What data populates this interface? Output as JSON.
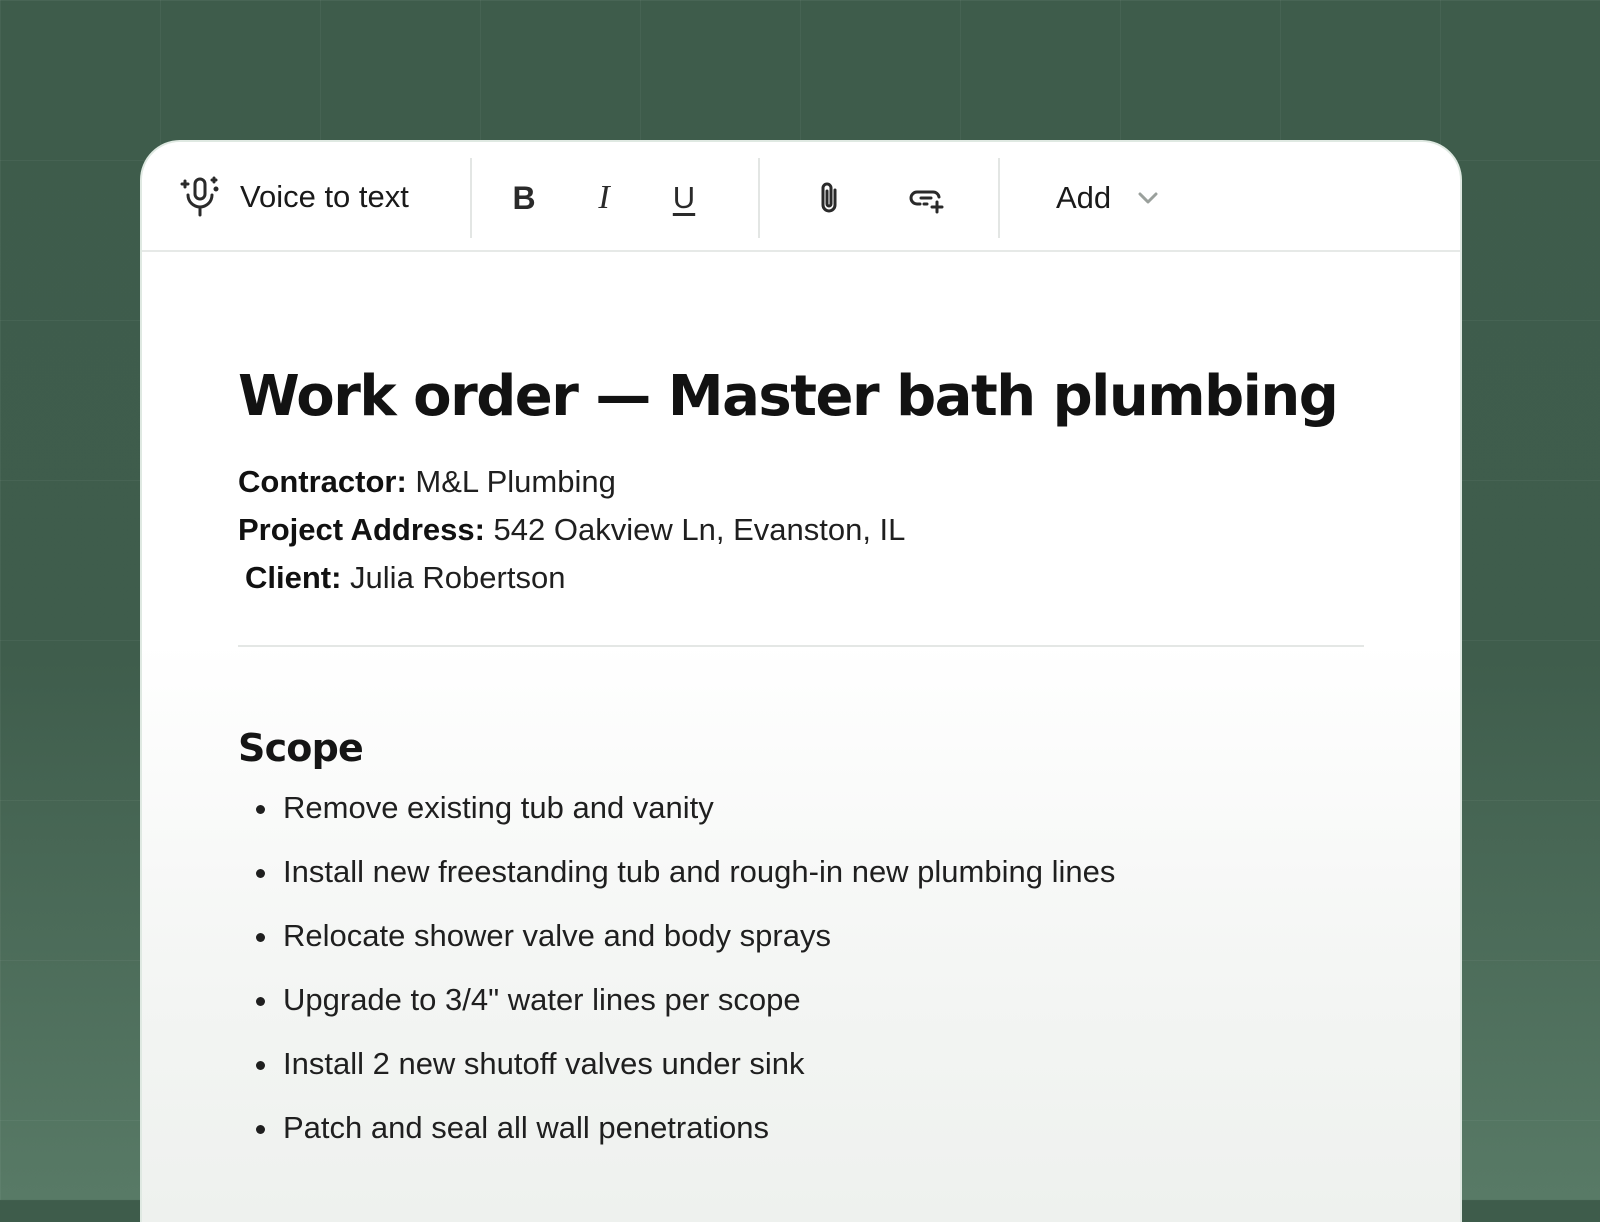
{
  "toolbar": {
    "voice_label": "Voice to text",
    "bold_glyph": "B",
    "italic_glyph": "I",
    "underline_glyph": "U",
    "add_label": "Add",
    "icons": [
      "mic-sparkle-icon",
      "bold-icon",
      "italic-icon",
      "underline-icon",
      "paperclip-icon",
      "add-link-icon",
      "chevron-down-icon"
    ]
  },
  "document": {
    "title": "Work order — Master bath plumbing",
    "contractor_label": "Contractor:",
    "contractor_value": " M&L Plumbing",
    "address_label": "Project Address:",
    "address_value": " 542 Oakview Ln, Evanston, IL",
    "client_label": "Client:",
    "client_value": " Julia Robertson",
    "scope_heading": "Scope",
    "scope_items": [
      "Remove existing tub and vanity",
      "Install new freestanding tub and rough-in new plumbing lines",
      "Relocate shower valve and body sprays",
      "Upgrade to 3/4\" water lines per scope",
      "Install 2 new shutoff valves under sink",
      "Patch and seal all wall penetrations"
    ]
  },
  "colors": {
    "background": "#3f5d4c",
    "card": "#ffffff",
    "text": "#1f1f1f",
    "divider": "#e4e7e5"
  }
}
